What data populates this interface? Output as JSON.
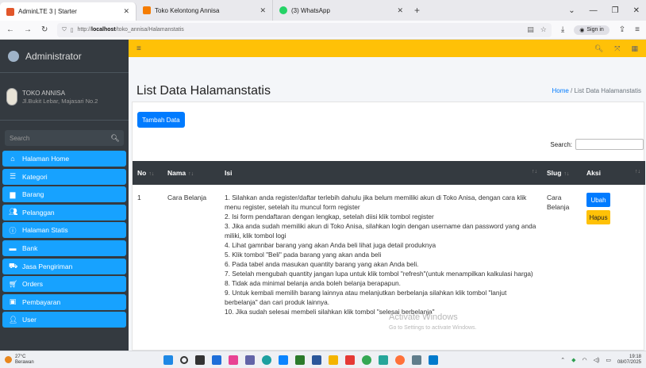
{
  "browser": {
    "tabs": [
      {
        "title": "AdminLTE 3 | Starter",
        "color": "#e2572b",
        "active": true
      },
      {
        "title": "Toko Kelontong Annisa",
        "color": "#f57c00",
        "active": false
      },
      {
        "title": "(3) WhatsApp",
        "color": "#25d366",
        "active": false
      }
    ],
    "url_prefix": "http://",
    "url_host": "localhost",
    "url_path": "/toko_annisa/Halamanstatis",
    "sign_in": "Sign in"
  },
  "sidebar": {
    "brand": "Administrator",
    "store_name": "TOKO ANNISA",
    "store_address": "Jl.Bukit Lebar, Majasari No.2",
    "search_placeholder": "Search",
    "items": [
      {
        "label": "Halaman Home",
        "icon": "home-icon"
      },
      {
        "label": "Kategori",
        "icon": "list-icon"
      },
      {
        "label": "Barang",
        "icon": "box-icon"
      },
      {
        "label": "Pelanggan",
        "icon": "users-icon"
      },
      {
        "label": "Halaman Statis",
        "icon": "info-icon"
      },
      {
        "label": "Bank",
        "icon": "bank-icon"
      },
      {
        "label": "Jasa Pengiriman",
        "icon": "truck-icon"
      },
      {
        "label": "Orders",
        "icon": "cart-icon"
      },
      {
        "label": "Pembayaran",
        "icon": "money-icon"
      },
      {
        "label": "User",
        "icon": "user-icon"
      }
    ],
    "accent": "#17a2ff"
  },
  "page": {
    "title": "List Data Halamanstatis",
    "breadcrumb_home": "Home",
    "breadcrumb_sep": "/",
    "breadcrumb_current": "List Data Halamanstatis",
    "add_button": "Tambah Data",
    "search_label": "Search:"
  },
  "table": {
    "headers": [
      "No",
      "Nama",
      "Isi",
      "Slug",
      "Aksi"
    ],
    "rows": [
      {
        "no": "1",
        "nama": "Cara Belanja",
        "slug": "Cara Belanja",
        "isi": [
          "1. Silahkan anda register/daftar terlebih dahulu jika belum memiliki akun di Toko Anisa, dengan cara klik menu register, setelah itu muncul form register",
          "2. Isi form pendaftaran dengan lengkap, setelah diisi klik tombol register",
          "3. Jika anda sudah memiliki akun di Toko Anisa, silahkan login dengan username dan password yang anda miliki, klik tombol logi",
          "4. Lihat gamnbar barang yang akan Anda beli lihat juga detail produknya",
          "5. Klik tombol \"Beli\" pada barang yang akan anda beli",
          "6. Pada tabel anda masukan quantity barang yang akan Anda beli.",
          "7. Setelah mengubah quantity jangan lupa untuk klik tombol \"refresh\"(untuk menampilkan kalkulasi harga)",
          "8. Tidak ada minimal belanja anda boleh belanja berapapun.",
          "9. Untuk kembali memilih barang lainnya atau melanjutkan berbelanja silahkan klik tombol \"lanjut berbelanja\" dan cari produk lainnya.",
          "10. Jika sudah selesai membeli silahkan klik tombol \"selesai berbelanja\""
        ],
        "edit_label": "Ubah",
        "delete_label": "Hapus"
      }
    ]
  },
  "watermark": {
    "title": "Activate Windows",
    "subtitle": "Go to Settings to activate Windows."
  },
  "taskbar": {
    "temperature": "27°C",
    "weather": "Berawan",
    "time": "19:18",
    "date": "08/07/2025"
  }
}
